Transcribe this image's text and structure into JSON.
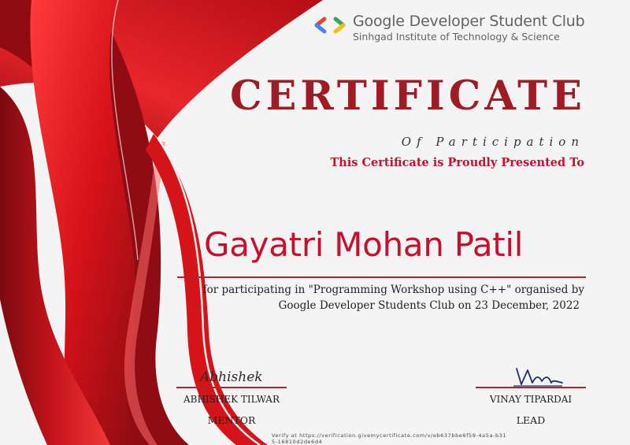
{
  "header": {
    "club_name": "Google Developer Student Club",
    "institute": "Sinhgad Institute of Technology & Science",
    "logo_icon": "gdsc-brackets-icon",
    "logo_colors": [
      "#4285F4",
      "#EA4335",
      "#34A853",
      "#FBBC04"
    ]
  },
  "certificate": {
    "title": "CERTIFICATE",
    "subtitle": "Of Participation",
    "presented_line": "This Certificate is Proudly Presented To",
    "recipient": "Gayatri Mohan Patil",
    "description_line1": "for participating in \"Programming Workshop using C++\" organised by",
    "description_line2": "Google Developer Students Club on 23 December, 2022"
  },
  "signatories": {
    "mentor": {
      "signature": "Abhishek",
      "name": "ABHISHEK TILWAR",
      "role": "MENTOR"
    },
    "lead": {
      "name": "VINAY TIPARDAI",
      "role": "LEAD"
    }
  },
  "footer": {
    "verify_text": "Verify at https://verification.givemycertificate.com/v/eb637bbe6f59-4a5a-b315-16810d2de6d4"
  },
  "colors": {
    "title": "#a01c25",
    "accent_red": "#c8102e",
    "ribbon_dark": "#8e0c12",
    "ribbon_mid": "#c8141c",
    "ribbon_light": "#e8262c"
  }
}
